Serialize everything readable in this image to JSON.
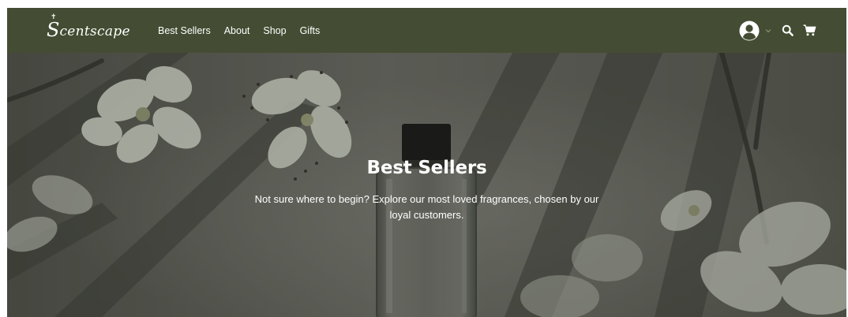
{
  "brand": {
    "logo_initial": "S",
    "logo_rest": "centscape"
  },
  "nav": {
    "links": [
      "Best Sellers",
      "About",
      "Shop",
      "Gifts"
    ]
  },
  "icons": {
    "account": "user-circle-icon",
    "account_menu": "chevron-down-icon",
    "search": "search-icon",
    "cart": "cart-icon"
  },
  "hero": {
    "title": "Best Sellers",
    "subtitle": "Not sure where to begin? Explore our most loved fragrances, chosen by our loyal customers."
  },
  "colors": {
    "nav_bg": "#444d33",
    "text": "#ffffff",
    "hero_overlay": "#5b5b52"
  }
}
